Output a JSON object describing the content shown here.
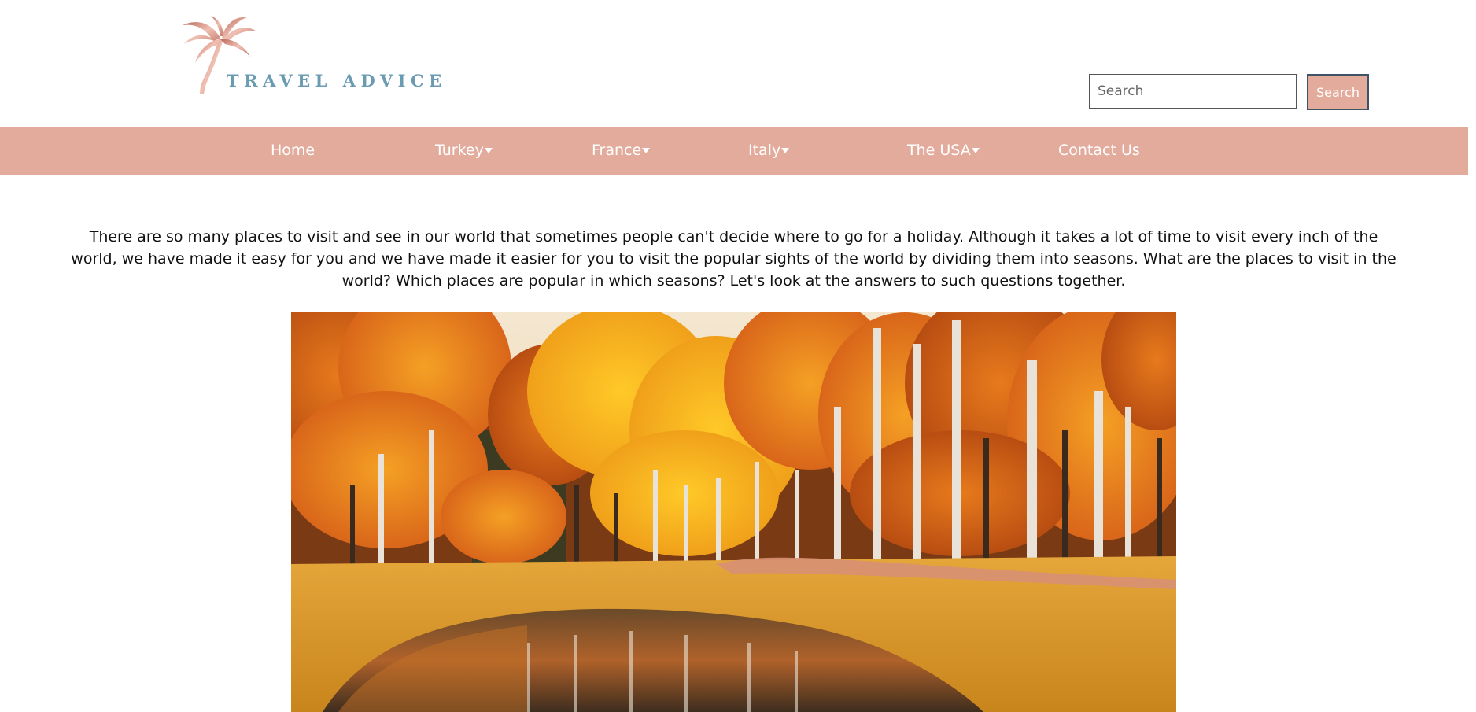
{
  "brand": {
    "name": "TRAVEL ADVICE",
    "logo_icon": "palm-tree-icon",
    "logo_color": "#6b9bb3",
    "palm_color": "#d8958a"
  },
  "search": {
    "placeholder": "Search",
    "value": "",
    "button_label": "Search"
  },
  "colors": {
    "nav_background": "#e3ab9c",
    "button_border": "#3e5566",
    "text": "#111111"
  },
  "nav": {
    "items": [
      {
        "label": "Home",
        "dropdown": false
      },
      {
        "label": "Turkey",
        "dropdown": true
      },
      {
        "label": "France",
        "dropdown": true
      },
      {
        "label": "Italy",
        "dropdown": true
      },
      {
        "label": "The USA",
        "dropdown": true
      },
      {
        "label": "Contact Us",
        "dropdown": false
      }
    ]
  },
  "intro": {
    "text": "There are so many places to visit and see in our world that sometimes people can't decide where to go for a holiday. Although it takes a lot of time to visit every inch of the world, we have made it easy for you and we have made it easier for you to visit the popular sights of the world by dividing them into seasons. What are the places to visit in the world? Which places are popular in which seasons? Let's look at the answers to such questions together."
  },
  "hero": {
    "icon": "autumn-forest-pond-image"
  }
}
